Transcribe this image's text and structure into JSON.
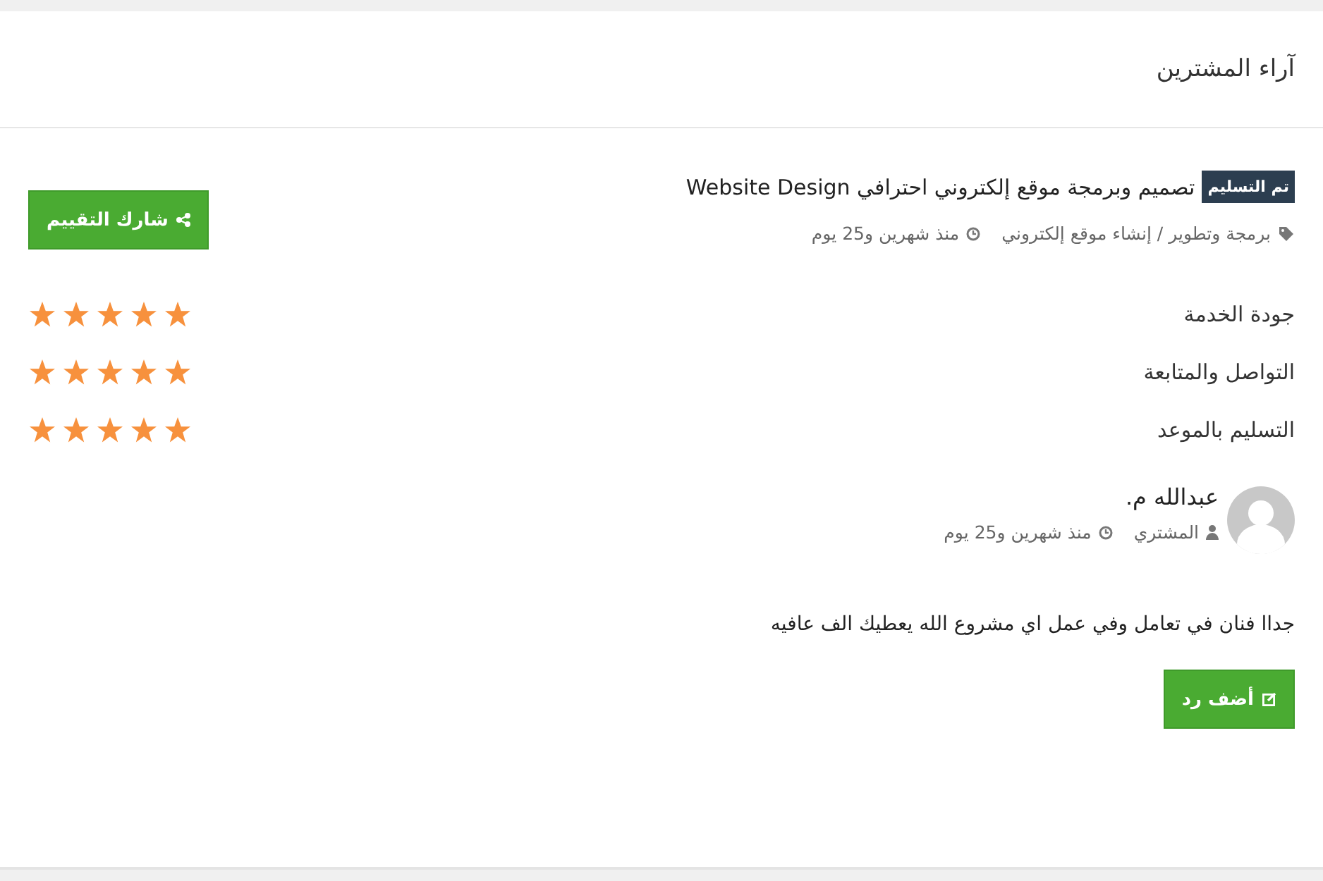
{
  "section_title": "آراء المشترين",
  "project": {
    "badge": "تم التسليم",
    "title": "تصميم وبرمجة موقع إلكتروني احترافي Website Design",
    "category": "برمجة وتطوير / إنشاء موقع إلكتروني",
    "time": "منذ شهرين و25 يوم"
  },
  "share_button": "شارك التقييم",
  "ratings": [
    {
      "label": "جودة الخدمة",
      "stars": 5
    },
    {
      "label": "التواصل والمتابعة",
      "stars": 5
    },
    {
      "label": "التسليم بالموعد",
      "stars": 5
    }
  ],
  "review": {
    "name": "عبدالله م.",
    "role": "المشتري",
    "time": "منذ شهرين و25 يوم",
    "text": "جداا فنان في تعامل وفي عمل اي مشروع الله يعطيك الف عافيه"
  },
  "reply_button": "أضف رد"
}
